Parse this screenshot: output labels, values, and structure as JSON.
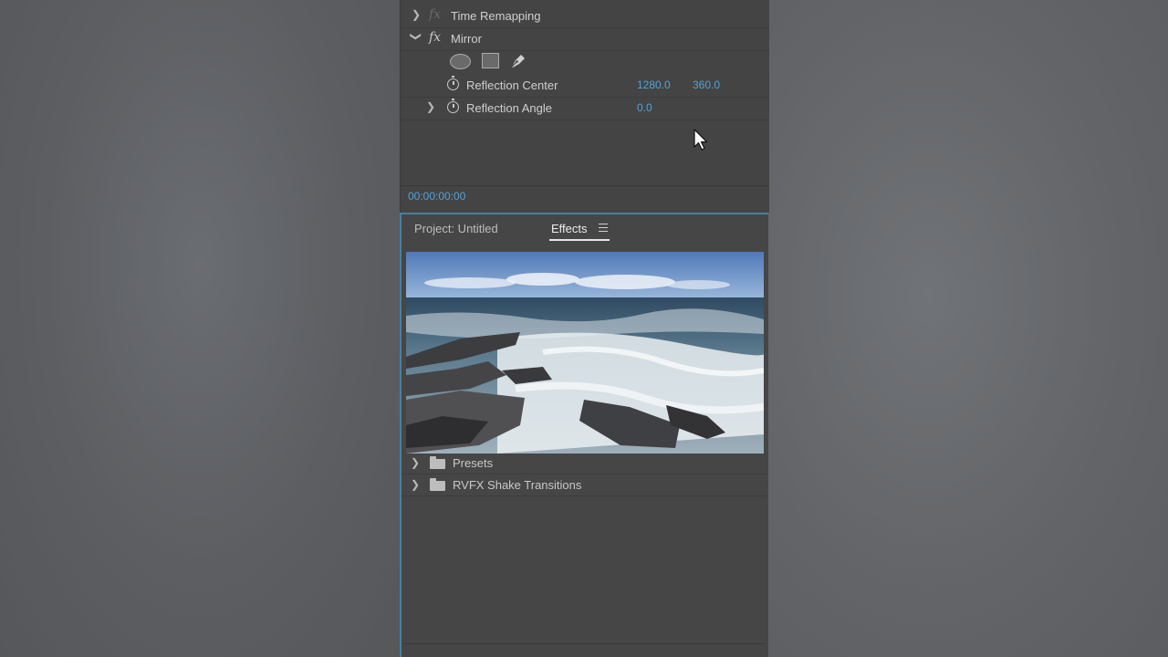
{
  "effect_controls": {
    "time_remapping": {
      "fx_symbol": "fx",
      "label": "Time Remapping"
    },
    "mirror": {
      "fx_symbol": "fx",
      "label": "Mirror"
    },
    "mask_tools": [
      "ellipse-mask-icon",
      "rectangle-mask-icon",
      "pen-mask-icon"
    ],
    "reflection_center": {
      "label": "Reflection Center",
      "x": "1280.0",
      "y": "360.0"
    },
    "reflection_angle": {
      "label": "Reflection Angle",
      "value": "0.0"
    },
    "timecode": "00:00:00:00"
  },
  "effects_panel": {
    "tabs": [
      {
        "label": "Project: Untitled",
        "active": false
      },
      {
        "label": "Effects",
        "active": true
      }
    ],
    "tree": [
      {
        "label": "Presets",
        "icon": "folder-icon"
      },
      {
        "label": "RVFX Shake Transitions",
        "icon": "folder-star-icon"
      }
    ]
  },
  "colors": {
    "accent": "#4fa3d9",
    "panel_bg": "#444444",
    "focus_border": "#4a7fa0"
  }
}
